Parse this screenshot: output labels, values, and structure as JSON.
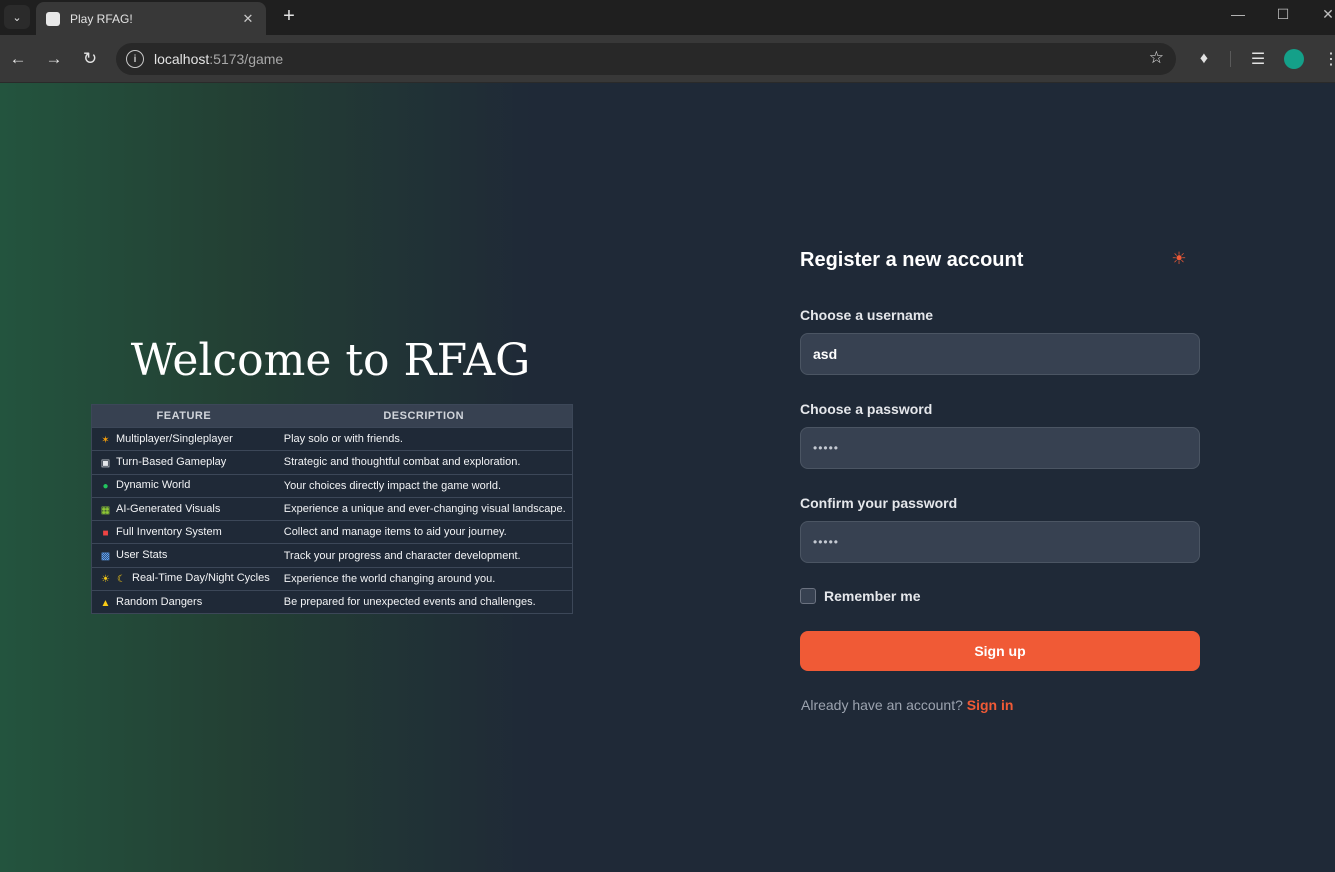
{
  "browser": {
    "tab_title": "Play RFAG!",
    "url_host": "localhost",
    "url_path": ":5173/game"
  },
  "page": {
    "heading": "Welcome to RFAG",
    "table": {
      "headers": [
        "FEATURE",
        "DESCRIPTION"
      ],
      "rows": [
        {
          "icon": "people-icon",
          "feature": "Multiplayer/Singleplayer",
          "description": "Play solo or with friends."
        },
        {
          "icon": "dice-icon",
          "feature": "Turn-Based Gameplay",
          "description": "Strategic and thoughtful combat and exploration."
        },
        {
          "icon": "globe-icon",
          "feature": "Dynamic World",
          "description": "Your choices directly impact the game world."
        },
        {
          "icon": "picture-icon",
          "feature": "AI-Generated Visuals",
          "description": "Experience a unique and ever-changing visual landscape."
        },
        {
          "icon": "backpack-icon",
          "feature": "Full Inventory System",
          "description": "Collect and manage items to aid your journey."
        },
        {
          "icon": "bar-chart-icon",
          "feature": "User Stats",
          "description": "Track your progress and character development."
        },
        {
          "icon": "sun-moon-icon",
          "feature": "Real-Time Day/Night Cycles",
          "description": "Experience the world changing around you."
        },
        {
          "icon": "warning-icon",
          "feature": "Random Dangers",
          "description": "Be prepared for unexpected events and challenges."
        }
      ]
    }
  },
  "form": {
    "title": "Register a new account",
    "username_label": "Choose a username",
    "username_value": "asd",
    "password_label": "Choose a password",
    "password_value": "•••••",
    "confirm_label": "Confirm your password",
    "confirm_value": "•••••",
    "remember_label": "Remember me",
    "submit_label": "Sign up",
    "signin_prompt": "Already have an account?",
    "signin_link": "Sign in"
  },
  "colors": {
    "accent": "#f05a36",
    "background": "#1f2937",
    "input_bg": "#374151"
  }
}
